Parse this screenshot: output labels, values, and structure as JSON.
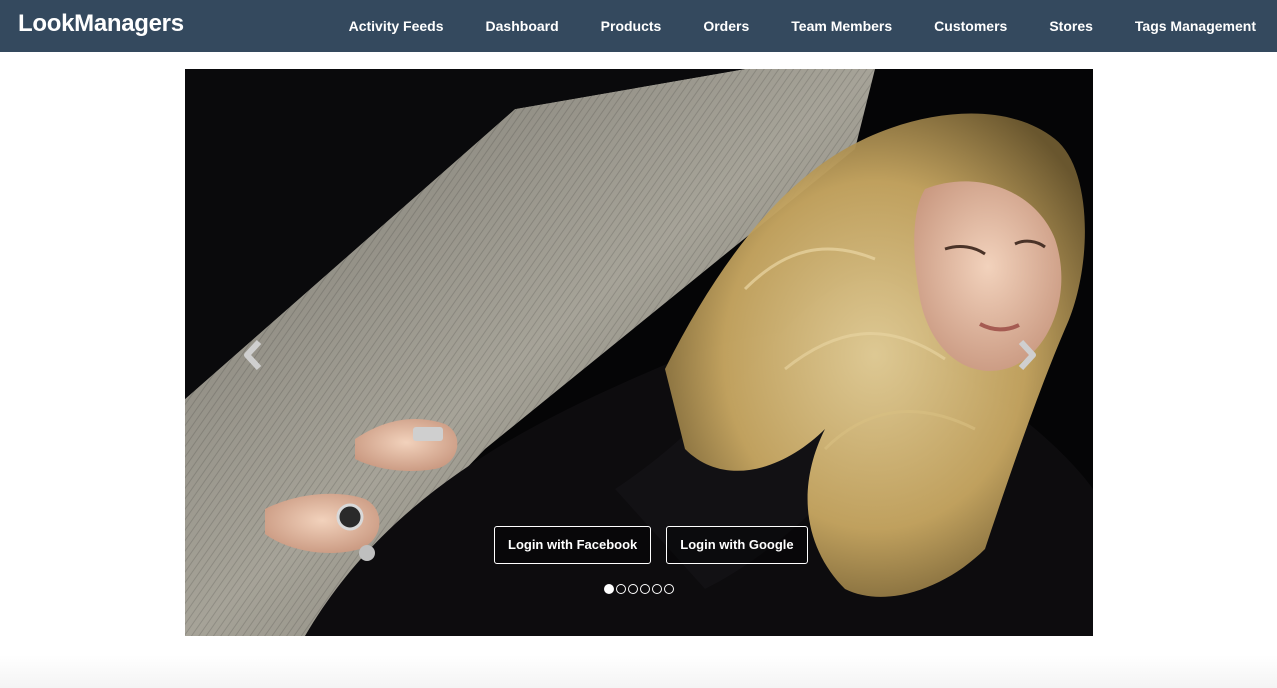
{
  "app": {
    "brand": "LookManagers"
  },
  "nav": {
    "items": [
      {
        "label": "Activity Feeds"
      },
      {
        "label": "Dashboard"
      },
      {
        "label": "Products"
      },
      {
        "label": "Orders"
      },
      {
        "label": "Team Members"
      },
      {
        "label": "Customers"
      },
      {
        "label": "Stores"
      },
      {
        "label": "Tags Management"
      }
    ]
  },
  "carousel": {
    "slide_count": 6,
    "active_slide": 1,
    "prev_icon": "chevron-left-icon",
    "next_icon": "chevron-right-icon",
    "buttons": {
      "facebook_label": "Login with Facebook",
      "google_label": "Login with Google"
    }
  },
  "colors": {
    "navbar": "#34495e",
    "nav_text": "#ffffff"
  }
}
